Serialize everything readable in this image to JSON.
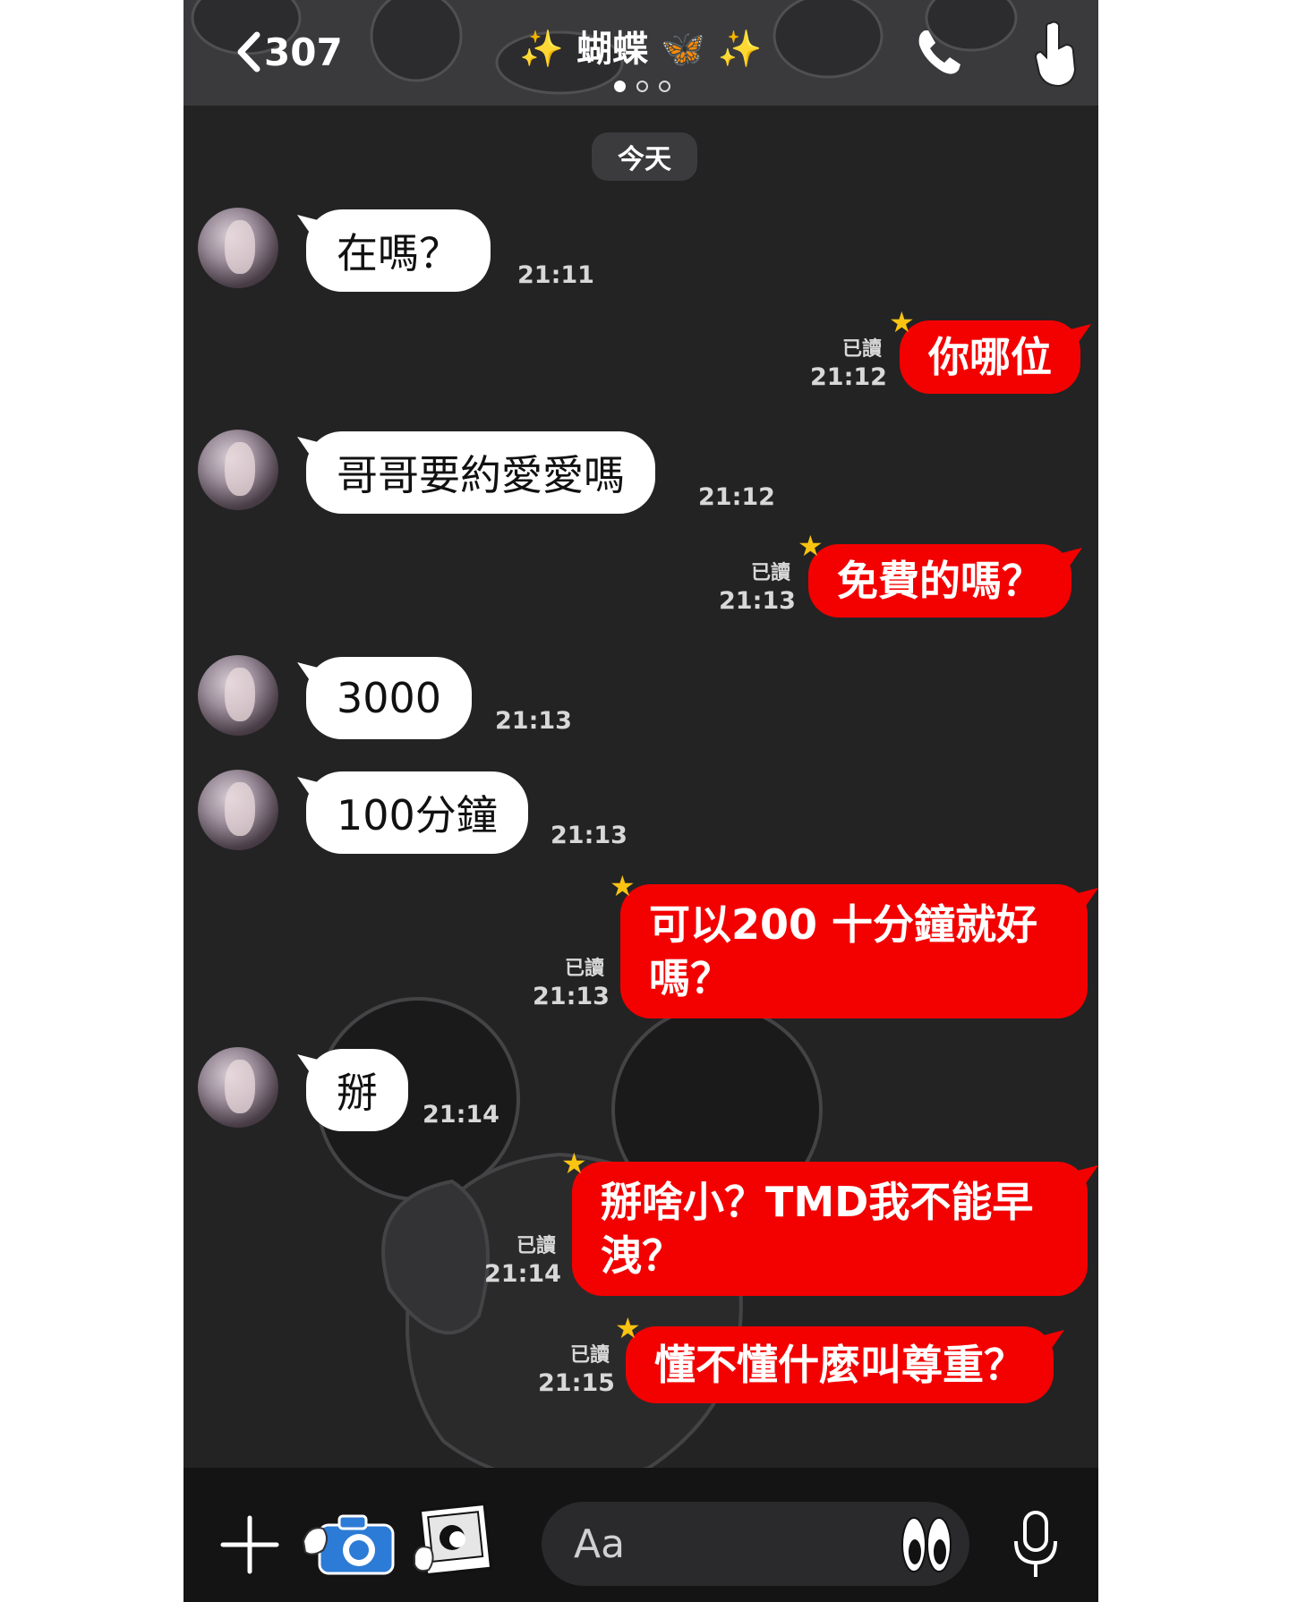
{
  "header": {
    "back_count": "307",
    "title_spark_left": "✨",
    "title_name": "蝴蝶",
    "title_butterfly": "🦋",
    "title_spark_right": "✨",
    "page_dots": 3,
    "active_page": 1
  },
  "date_divider": "今天",
  "messages": [
    {
      "dir": "in",
      "text": "在嗎？",
      "time": "21:11"
    },
    {
      "dir": "out",
      "text": "你哪位",
      "read": "已讀",
      "time": "21:12"
    },
    {
      "dir": "in",
      "text": "哥哥要約愛愛嗎",
      "time": "21:12"
    },
    {
      "dir": "out",
      "text": "免費的嗎？",
      "read": "已讀",
      "time": "21:13"
    },
    {
      "dir": "in",
      "text": "3000",
      "time": "21:13"
    },
    {
      "dir": "in",
      "text": "100分鐘",
      "time": "21:13"
    },
    {
      "dir": "out",
      "text_line1": "可以200 十分鐘就好",
      "text_line2": "嗎？",
      "read": "已讀",
      "time": "21:13"
    },
    {
      "dir": "in",
      "text": "掰",
      "time": "21:14"
    },
    {
      "dir": "out",
      "text_line1": "掰啥小？TMD我不能早",
      "text_line2": "洩？",
      "read": "已讀",
      "time": "21:14"
    },
    {
      "dir": "out",
      "text": "懂不懂什麼叫尊重？",
      "read": "已讀",
      "time": "21:15"
    }
  ],
  "composer": {
    "placeholder": "Aa"
  },
  "icons": {
    "back": "chevron-left-icon",
    "call": "phone-icon",
    "more": "hand-pointer-icon",
    "plus": "plus-icon",
    "camera": "camera-icon",
    "gallery": "photo-icon",
    "emoji": "eyes-emoji-icon",
    "mic": "microphone-icon"
  },
  "colors": {
    "background": "#232324",
    "incoming_bubble": "#ffffff",
    "outgoing_bubble": "#f30000",
    "star": "#f9c312"
  }
}
